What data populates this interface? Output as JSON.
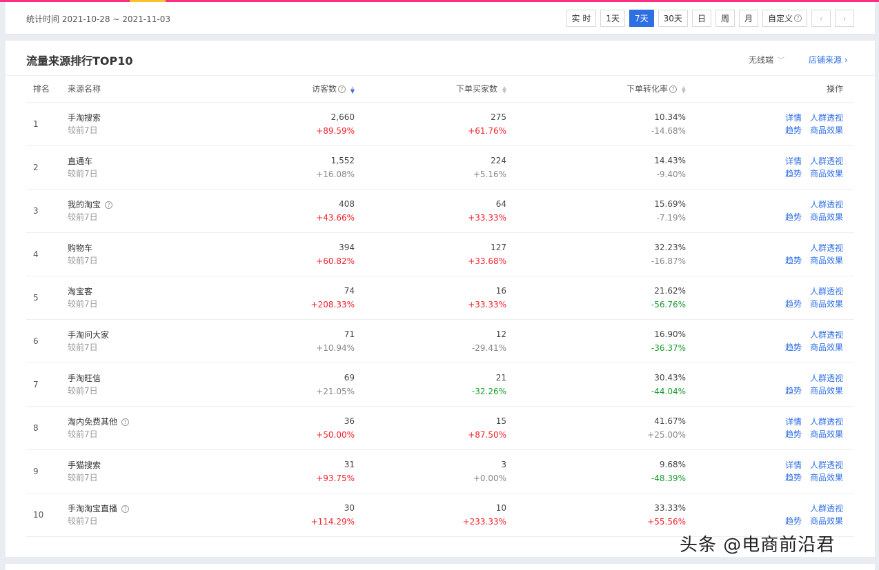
{
  "date_bar": {
    "label": "统计时间 2021-10-28 ~ 2021-11-03",
    "buttons": [
      "实 时",
      "1天",
      "7天",
      "30天",
      "日",
      "周",
      "月",
      "自定义"
    ],
    "active": "7天",
    "prev": "‹",
    "next": "›"
  },
  "panel": {
    "title": "流量来源排行TOP10",
    "terminal": "无线端",
    "shop_link": "店铺来源 ›"
  },
  "table": {
    "headers": {
      "rank": "排名",
      "name": "来源名称",
      "visitors": "访客数",
      "buyers": "下单买家数",
      "conversion": "下单转化率",
      "ops": "操作"
    },
    "rows": [
      {
        "rank": "1",
        "name": "手淘搜索",
        "help": false,
        "sub": "较前7日",
        "visitors": "2,660",
        "visitors_chg": "+89.59%",
        "visitors_dir": "up",
        "buyers": "275",
        "buyers_chg": "+61.76%",
        "buyers_dir": "up",
        "conv": "10.34%",
        "conv_chg": "-14.68%",
        "conv_dir": "neutral",
        "op1": [
          "详情",
          "人群透视"
        ],
        "op2": [
          "趋势",
          "商品效果"
        ]
      },
      {
        "rank": "2",
        "name": "直通车",
        "help": false,
        "sub": "较前7日",
        "visitors": "1,552",
        "visitors_chg": "+16.08%",
        "visitors_dir": "neutral",
        "buyers": "224",
        "buyers_chg": "+5.16%",
        "buyers_dir": "neutral",
        "conv": "14.43%",
        "conv_chg": "-9.40%",
        "conv_dir": "neutral",
        "op1": [
          "详情",
          "人群透视"
        ],
        "op2": [
          "趋势",
          "商品效果"
        ]
      },
      {
        "rank": "3",
        "name": "我的淘宝",
        "help": true,
        "sub": "较前7日",
        "visitors": "408",
        "visitors_chg": "+43.66%",
        "visitors_dir": "up",
        "buyers": "64",
        "buyers_chg": "+33.33%",
        "buyers_dir": "up",
        "conv": "15.69%",
        "conv_chg": "-7.19%",
        "conv_dir": "neutral",
        "op1": [
          "",
          "人群透视"
        ],
        "op2": [
          "趋势",
          "商品效果"
        ]
      },
      {
        "rank": "4",
        "name": "购物车",
        "help": false,
        "sub": "较前7日",
        "visitors": "394",
        "visitors_chg": "+60.82%",
        "visitors_dir": "up",
        "buyers": "127",
        "buyers_chg": "+33.68%",
        "buyers_dir": "up",
        "conv": "32.23%",
        "conv_chg": "-16.87%",
        "conv_dir": "neutral",
        "op1": [
          "",
          "人群透视"
        ],
        "op2": [
          "趋势",
          "商品效果"
        ]
      },
      {
        "rank": "5",
        "name": "淘宝客",
        "help": false,
        "sub": "较前7日",
        "visitors": "74",
        "visitors_chg": "+208.33%",
        "visitors_dir": "up",
        "buyers": "16",
        "buyers_chg": "+33.33%",
        "buyers_dir": "up",
        "conv": "21.62%",
        "conv_chg": "-56.76%",
        "conv_dir": "down",
        "op1": [
          "",
          "人群透视"
        ],
        "op2": [
          "趋势",
          "商品效果"
        ]
      },
      {
        "rank": "6",
        "name": "手淘问大家",
        "help": false,
        "sub": "较前7日",
        "visitors": "71",
        "visitors_chg": "+10.94%",
        "visitors_dir": "neutral",
        "buyers": "12",
        "buyers_chg": "-29.41%",
        "buyers_dir": "neutral",
        "conv": "16.90%",
        "conv_chg": "-36.37%",
        "conv_dir": "down",
        "op1": [
          "",
          "人群透视"
        ],
        "op2": [
          "趋势",
          "商品效果"
        ]
      },
      {
        "rank": "7",
        "name": "手淘旺信",
        "help": false,
        "sub": "较前7日",
        "visitors": "69",
        "visitors_chg": "+21.05%",
        "visitors_dir": "neutral",
        "buyers": "21",
        "buyers_chg": "-32.26%",
        "buyers_dir": "down",
        "conv": "30.43%",
        "conv_chg": "-44.04%",
        "conv_dir": "down",
        "op1": [
          "",
          "人群透视"
        ],
        "op2": [
          "趋势",
          "商品效果"
        ]
      },
      {
        "rank": "8",
        "name": "淘内免费其他",
        "help": true,
        "sub": "较前7日",
        "visitors": "36",
        "visitors_chg": "+50.00%",
        "visitors_dir": "up",
        "buyers": "15",
        "buyers_chg": "+87.50%",
        "buyers_dir": "up",
        "conv": "41.67%",
        "conv_chg": "+25.00%",
        "conv_dir": "neutral",
        "op1": [
          "详情",
          "人群透视"
        ],
        "op2": [
          "趋势",
          "商品效果"
        ]
      },
      {
        "rank": "9",
        "name": "手猫搜索",
        "help": false,
        "sub": "较前7日",
        "visitors": "31",
        "visitors_chg": "+93.75%",
        "visitors_dir": "up",
        "buyers": "3",
        "buyers_chg": "+0.00%",
        "buyers_dir": "neutral",
        "conv": "9.68%",
        "conv_chg": "-48.39%",
        "conv_dir": "down",
        "op1": [
          "详情",
          "人群透视"
        ],
        "op2": [
          "趋势",
          "商品效果"
        ]
      },
      {
        "rank": "10",
        "name": "手淘淘宝直播",
        "help": true,
        "sub": "较前7日",
        "visitors": "30",
        "visitors_chg": "+114.29%",
        "visitors_dir": "up",
        "buyers": "10",
        "buyers_chg": "+233.33%",
        "buyers_dir": "up",
        "conv": "33.33%",
        "conv_chg": "+55.56%",
        "conv_dir": "up",
        "op1": [
          "",
          "人群透视"
        ],
        "op2": [
          "趋势",
          "商品效果"
        ]
      }
    ]
  },
  "watermark": "头条 @电商前沿君"
}
